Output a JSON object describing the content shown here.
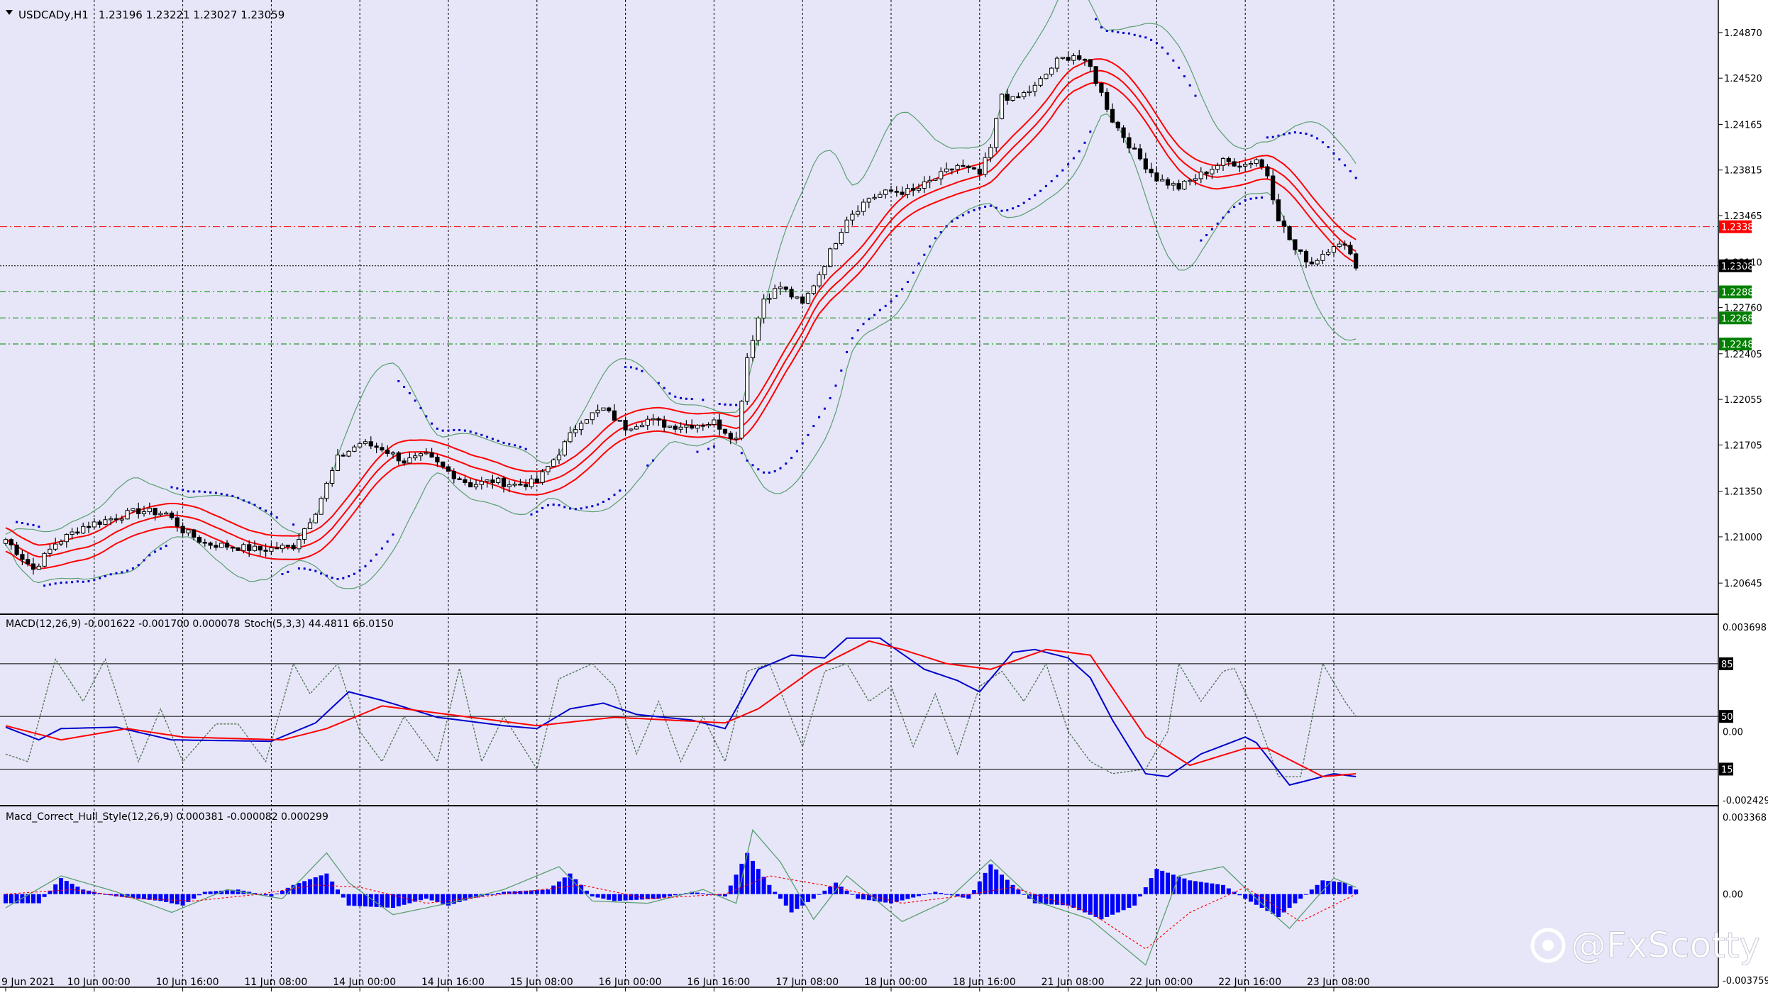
{
  "symbol_header": {
    "symbol": "USDCADy,H1",
    "ohlc": "1.23196 1.23221 1.23027 1.23059"
  },
  "macd_header": "MACD(12,26,9) -0.001622 -0.001700 0.000078",
  "stoch_header": "Stoch(5,3,3) 44.4811 66.0150",
  "hull_header": "Macd_Correct_Hull_Style(12,26,9) 0.000381 -0.000082 0.000299",
  "watermark": "@FxScotty",
  "colors": {
    "background": "#e6e6f8",
    "grid": "#000000",
    "bull": "#ffffff",
    "bear": "#000000",
    "envelope": "#ff0000",
    "bollinger": "#5a9e6f",
    "sar": "#0000cc",
    "macd_main": "#0000cc",
    "macd_signal": "#ff0000",
    "stoch": "#4f6f4f",
    "hist": "#0000ff",
    "price_tag_red": "#ff0000",
    "price_tag_black": "#000000",
    "price_tag_green": "#008000"
  },
  "chart_data": [
    {
      "type": "candlestick",
      "panel": "price",
      "ylim": [
        1.2045,
        1.25
      ],
      "y_ticks": [
        "1.24870",
        "1.24520",
        "1.24165",
        "1.23815",
        "1.23465",
        "1.23110",
        "1.22760",
        "1.22405",
        "1.22055",
        "1.21705",
        "1.21350",
        "1.21000",
        "1.20645"
      ],
      "x_ticks": [
        "9 Jun 2021",
        "10 Jun 00:00",
        "10 Jun 16:00",
        "11 Jun 08:00",
        "14 Jun 00:00",
        "14 Jun 16:00",
        "15 Jun 08:00",
        "16 Jun 00:00",
        "16 Jun 16:00",
        "17 Jun 08:00",
        "18 Jun 00:00",
        "18 Jun 16:00",
        "21 Jun 08:00",
        "22 Jun 00:00",
        "22 Jun 16:00",
        "23 Jun 08:00"
      ],
      "price_levels": [
        {
          "value": 1.2338,
          "label": "1.23380",
          "style": "red"
        },
        {
          "value": 1.2308,
          "label": "1.23080",
          "style": "black"
        },
        {
          "value": 1.2288,
          "label": "1.22880",
          "style": "green"
        },
        {
          "value": 1.2268,
          "label": "1.22680",
          "style": "green"
        },
        {
          "value": 1.2248,
          "label": "1.22480",
          "style": "green"
        }
      ],
      "close_anchors": [
        [
          0,
          1.2098
        ],
        [
          5,
          1.2075
        ],
        [
          9,
          1.2095
        ],
        [
          14,
          1.2108
        ],
        [
          19,
          1.2114
        ],
        [
          24,
          1.212
        ],
        [
          29,
          1.2118
        ],
        [
          32,
          1.2105
        ],
        [
          36,
          1.2095
        ],
        [
          40,
          1.2093
        ],
        [
          46,
          1.209
        ],
        [
          52,
          1.2093
        ],
        [
          56,
          1.212
        ],
        [
          60,
          1.216
        ],
        [
          64,
          1.2172
        ],
        [
          68,
          1.2168
        ],
        [
          72,
          1.2158
        ],
        [
          76,
          1.2162
        ],
        [
          80,
          1.215
        ],
        [
          84,
          1.214
        ],
        [
          88,
          1.2143
        ],
        [
          92,
          1.214
        ],
        [
          96,
          1.2142
        ],
        [
          100,
          1.2165
        ],
        [
          104,
          1.219
        ],
        [
          108,
          1.2198
        ],
        [
          112,
          1.2184
        ],
        [
          116,
          1.219
        ],
        [
          120,
          1.2185
        ],
        [
          124,
          1.2186
        ],
        [
          128,
          1.2188
        ],
        [
          132,
          1.2175
        ],
        [
          134,
          1.2238
        ],
        [
          137,
          1.2283
        ],
        [
          140,
          1.2292
        ],
        [
          144,
          1.2278
        ],
        [
          148,
          1.231
        ],
        [
          152,
          1.2345
        ],
        [
          156,
          1.236
        ],
        [
          160,
          1.2365
        ],
        [
          164,
          1.2365
        ],
        [
          168,
          1.2375
        ],
        [
          172,
          1.2385
        ],
        [
          176,
          1.2378
        ],
        [
          178,
          1.2398
        ],
        [
          180,
          1.244
        ],
        [
          182,
          1.2435
        ],
        [
          186,
          1.2445
        ],
        [
          190,
          1.2465
        ],
        [
          193,
          1.247
        ],
        [
          196,
          1.246
        ],
        [
          200,
          1.242
        ],
        [
          204,
          1.2395
        ],
        [
          208,
          1.2375
        ],
        [
          212,
          1.2368
        ],
        [
          216,
          1.2378
        ],
        [
          220,
          1.2388
        ],
        [
          224,
          1.2386
        ],
        [
          226,
          1.239
        ],
        [
          228,
          1.2378
        ],
        [
          230,
          1.2345
        ],
        [
          233,
          1.232
        ],
        [
          236,
          1.231
        ],
        [
          240,
          1.2325
        ],
        [
          243,
          1.232
        ],
        [
          244,
          1.2306
        ]
      ],
      "x_tick_bars": [
        0,
        16,
        32,
        48,
        64,
        80,
        96,
        112,
        128,
        144,
        160,
        176,
        192,
        208,
        224,
        240
      ]
    },
    {
      "type": "line",
      "panel": "MACD + Stochastic",
      "ylim": [
        -0.002429,
        0.003698
      ],
      "y_ticks": [
        "0.003698",
        "0.00",
        "-0.002429"
      ],
      "stoch_levels": [
        "85",
        "50",
        "15"
      ],
      "macd_anchors": [
        [
          0,
          0.00015
        ],
        [
          6,
          -0.0003
        ],
        [
          10,
          0.0001
        ],
        [
          20,
          0.00015
        ],
        [
          30,
          -0.0003
        ],
        [
          48,
          -0.00035
        ],
        [
          56,
          0.0003
        ],
        [
          62,
          0.0014
        ],
        [
          68,
          0.0011
        ],
        [
          78,
          0.0005
        ],
        [
          90,
          0.0002
        ],
        [
          96,
          0.0001
        ],
        [
          102,
          0.0008
        ],
        [
          108,
          0.001
        ],
        [
          114,
          0.0006
        ],
        [
          124,
          0.0004
        ],
        [
          130,
          0.0001
        ],
        [
          136,
          0.0022
        ],
        [
          142,
          0.0027
        ],
        [
          148,
          0.0026
        ],
        [
          152,
          0.0033
        ],
        [
          158,
          0.0033
        ],
        [
          166,
          0.0022
        ],
        [
          172,
          0.0018
        ],
        [
          176,
          0.0014
        ],
        [
          182,
          0.0028
        ],
        [
          186,
          0.0029
        ],
        [
          192,
          0.0026
        ],
        [
          196,
          0.0019
        ],
        [
          200,
          0.0004
        ],
        [
          206,
          -0.0015
        ],
        [
          210,
          -0.0016
        ],
        [
          216,
          -0.0008
        ],
        [
          220,
          -0.0005
        ],
        [
          224,
          -0.0002
        ],
        [
          226,
          -0.0004
        ],
        [
          232,
          -0.0019
        ],
        [
          236,
          -0.0017
        ],
        [
          240,
          -0.0015
        ],
        [
          244,
          -0.0016
        ]
      ],
      "signal_anchors": [
        [
          0,
          0.0002
        ],
        [
          10,
          -0.0003
        ],
        [
          22,
          0.0001
        ],
        [
          32,
          -0.0002
        ],
        [
          50,
          -0.0003
        ],
        [
          58,
          0.0001
        ],
        [
          68,
          0.0009
        ],
        [
          80,
          0.0006
        ],
        [
          96,
          0.0002
        ],
        [
          110,
          0.0005
        ],
        [
          130,
          0.0003
        ],
        [
          136,
          0.0008
        ],
        [
          146,
          0.0022
        ],
        [
          156,
          0.0032
        ],
        [
          162,
          0.0029
        ],
        [
          170,
          0.0024
        ],
        [
          178,
          0.0022
        ],
        [
          188,
          0.0029
        ],
        [
          196,
          0.0027
        ],
        [
          206,
          -0.0002
        ],
        [
          214,
          -0.0012
        ],
        [
          224,
          -0.0006
        ],
        [
          228,
          -0.0006
        ],
        [
          238,
          -0.0016
        ],
        [
          244,
          -0.0015
        ]
      ],
      "stoch_anchors": [
        [
          0,
          25
        ],
        [
          4,
          20
        ],
        [
          9,
          88
        ],
        [
          14,
          60
        ],
        [
          18,
          88
        ],
        [
          24,
          20
        ],
        [
          28,
          55
        ],
        [
          32,
          20
        ],
        [
          38,
          45
        ],
        [
          42,
          45
        ],
        [
          47,
          20
        ],
        [
          52,
          85
        ],
        [
          55,
          65
        ],
        [
          60,
          85
        ],
        [
          64,
          40
        ],
        [
          68,
          20
        ],
        [
          72,
          50
        ],
        [
          78,
          20
        ],
        [
          82,
          82
        ],
        [
          86,
          20
        ],
        [
          90,
          50
        ],
        [
          96,
          15
        ],
        [
          100,
          75
        ],
        [
          106,
          85
        ],
        [
          110,
          70
        ],
        [
          114,
          25
        ],
        [
          118,
          60
        ],
        [
          122,
          20
        ],
        [
          126,
          50
        ],
        [
          130,
          20
        ],
        [
          134,
          80
        ],
        [
          138,
          85
        ],
        [
          144,
          30
        ],
        [
          148,
          80
        ],
        [
          152,
          85
        ],
        [
          156,
          60
        ],
        [
          160,
          70
        ],
        [
          164,
          30
        ],
        [
          168,
          65
        ],
        [
          172,
          25
        ],
        [
          176,
          70
        ],
        [
          180,
          80
        ],
        [
          184,
          60
        ],
        [
          188,
          85
        ],
        [
          192,
          40
        ],
        [
          196,
          20
        ],
        [
          200,
          12
        ],
        [
          206,
          15
        ],
        [
          210,
          40
        ],
        [
          212,
          85
        ],
        [
          216,
          60
        ],
        [
          220,
          80
        ],
        [
          222,
          82
        ],
        [
          226,
          50
        ],
        [
          230,
          10
        ],
        [
          234,
          10
        ],
        [
          238,
          85
        ],
        [
          242,
          60
        ],
        [
          244,
          50
        ]
      ]
    },
    {
      "type": "bar",
      "panel": "Macd_Correct_Hull_Style",
      "ylim": [
        -0.003759,
        0.003368
      ],
      "y_ticks": [
        "0.003368",
        "0.00",
        "-0.003759"
      ],
      "hist_anchors": [
        [
          0,
          -0.0004
        ],
        [
          6,
          -0.0004
        ],
        [
          10,
          0.0007
        ],
        [
          14,
          0.0002
        ],
        [
          20,
          -0.0001
        ],
        [
          28,
          -0.0003
        ],
        [
          32,
          -0.0005
        ],
        [
          36,
          0.0001
        ],
        [
          42,
          0.0002
        ],
        [
          48,
          -0.0001
        ],
        [
          52,
          0.0004
        ],
        [
          58,
          0.0009
        ],
        [
          62,
          -0.0005
        ],
        [
          70,
          -0.0006
        ],
        [
          76,
          -0.0002
        ],
        [
          80,
          -0.0005
        ],
        [
          84,
          -0.0002
        ],
        [
          90,
          0.0001
        ],
        [
          98,
          0.0002
        ],
        [
          102,
          0.0009
        ],
        [
          106,
          -0.0001
        ],
        [
          110,
          -0.0003
        ],
        [
          118,
          -0.0002
        ],
        [
          124,
          0.0001
        ],
        [
          130,
          -0.0001
        ],
        [
          134,
          0.0018
        ],
        [
          138,
          0.0004
        ],
        [
          142,
          -0.0008
        ],
        [
          146,
          -0.0002
        ],
        [
          150,
          0.0005
        ],
        [
          154,
          -0.0002
        ],
        [
          160,
          -0.0004
        ],
        [
          168,
          0.0001
        ],
        [
          174,
          -0.0002
        ],
        [
          178,
          0.0013
        ],
        [
          182,
          0.0004
        ],
        [
          186,
          -0.0004
        ],
        [
          192,
          -0.0005
        ],
        [
          198,
          -0.0011
        ],
        [
          204,
          -0.0005
        ],
        [
          208,
          0.0011
        ],
        [
          214,
          0.0006
        ],
        [
          220,
          0.0004
        ],
        [
          224,
          -0.0002
        ],
        [
          230,
          -0.001
        ],
        [
          234,
          -0.0002
        ],
        [
          238,
          0.0006
        ],
        [
          242,
          0.0005
        ],
        [
          244,
          0.0002
        ]
      ],
      "envelope_anchors": [
        [
          0,
          -0.0006
        ],
        [
          10,
          0.0008
        ],
        [
          20,
          0.0001
        ],
        [
          30,
          -0.0008
        ],
        [
          40,
          0.0002
        ],
        [
          50,
          -0.0002
        ],
        [
          58,
          0.0018
        ],
        [
          62,
          0.0005
        ],
        [
          70,
          -0.0009
        ],
        [
          80,
          -0.0004
        ],
        [
          90,
          0.0002
        ],
        [
          100,
          0.0012
        ],
        [
          106,
          -0.0003
        ],
        [
          116,
          -0.0004
        ],
        [
          126,
          0.0002
        ],
        [
          132,
          -0.0004
        ],
        [
          135,
          0.0028
        ],
        [
          140,
          0.0014
        ],
        [
          146,
          -0.0011
        ],
        [
          152,
          0.0008
        ],
        [
          162,
          -0.0012
        ],
        [
          170,
          -0.0003
        ],
        [
          178,
          0.0015
        ],
        [
          186,
          -0.0003
        ],
        [
          196,
          -0.0011
        ],
        [
          206,
          -0.0031
        ],
        [
          212,
          0.0008
        ],
        [
          220,
          0.0012
        ],
        [
          226,
          -0.0002
        ],
        [
          232,
          -0.0015
        ],
        [
          240,
          0.0007
        ],
        [
          244,
          0.0003
        ]
      ],
      "signal_anchors": [
        [
          0,
          0.0
        ],
        [
          12,
          0.0002
        ],
        [
          24,
          -0.0002
        ],
        [
          34,
          -0.0003
        ],
        [
          46,
          0.0
        ],
        [
          56,
          0.0004
        ],
        [
          64,
          0.0003
        ],
        [
          76,
          -0.0004
        ],
        [
          90,
          0.0
        ],
        [
          104,
          0.0004
        ],
        [
          116,
          -0.0002
        ],
        [
          130,
          0.0
        ],
        [
          138,
          0.0008
        ],
        [
          150,
          0.0003
        ],
        [
          162,
          -0.0004
        ],
        [
          172,
          -0.0001
        ],
        [
          182,
          0.0003
        ],
        [
          196,
          -0.0008
        ],
        [
          206,
          -0.0024
        ],
        [
          214,
          -0.0008
        ],
        [
          224,
          0.0003
        ],
        [
          234,
          -0.0012
        ],
        [
          244,
          0.0
        ]
      ]
    }
  ]
}
